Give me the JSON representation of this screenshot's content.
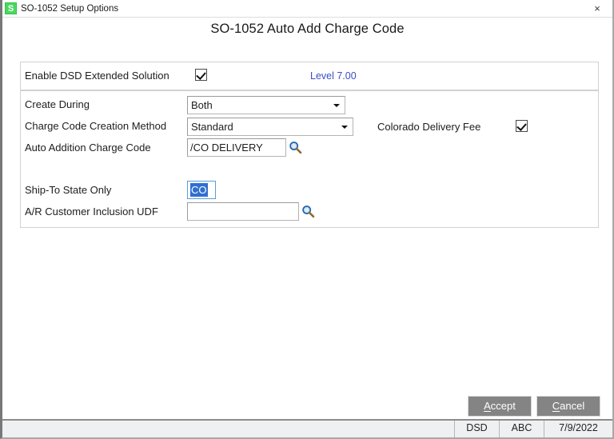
{
  "window": {
    "app_icon": "sage-icon",
    "title": "SO-1052 Setup Options",
    "close_icon": "×"
  },
  "heading": "SO-1052 Auto Add Charge Code",
  "top_panel": {
    "enable_label": "Enable DSD Extended Solution",
    "enable_checked": true,
    "level_text": "Level  7.00",
    "level_color": "#3b4fc4"
  },
  "form": {
    "create_during": {
      "label": "Create During",
      "value": "Both",
      "options": [
        "Both"
      ]
    },
    "charge_code_creation_method": {
      "label": "Charge Code Creation Method",
      "value": "Standard",
      "options": [
        "Standard"
      ]
    },
    "auto_addition_charge_code": {
      "label": "Auto Addition Charge Code",
      "value": "/CO DELIVERY",
      "lookup_icon": "magnifier-icon"
    },
    "colorado_delivery_fee": {
      "label": "Colorado Delivery Fee",
      "checked": true
    },
    "ship_to_state_only": {
      "label": "Ship-To State Only",
      "value": "CO",
      "selected": true
    },
    "ar_customer_inclusion_udf": {
      "label": "A/R Customer Inclusion UDF",
      "value": "",
      "lookup_icon": "magnifier-icon"
    }
  },
  "buttons": {
    "accept": "Accept",
    "accept_accel": "A",
    "cancel": "Cancel",
    "cancel_accel": "C"
  },
  "statusbar": {
    "company_code": "DSD",
    "company_name": "ABC",
    "date": "7/9/2022"
  }
}
